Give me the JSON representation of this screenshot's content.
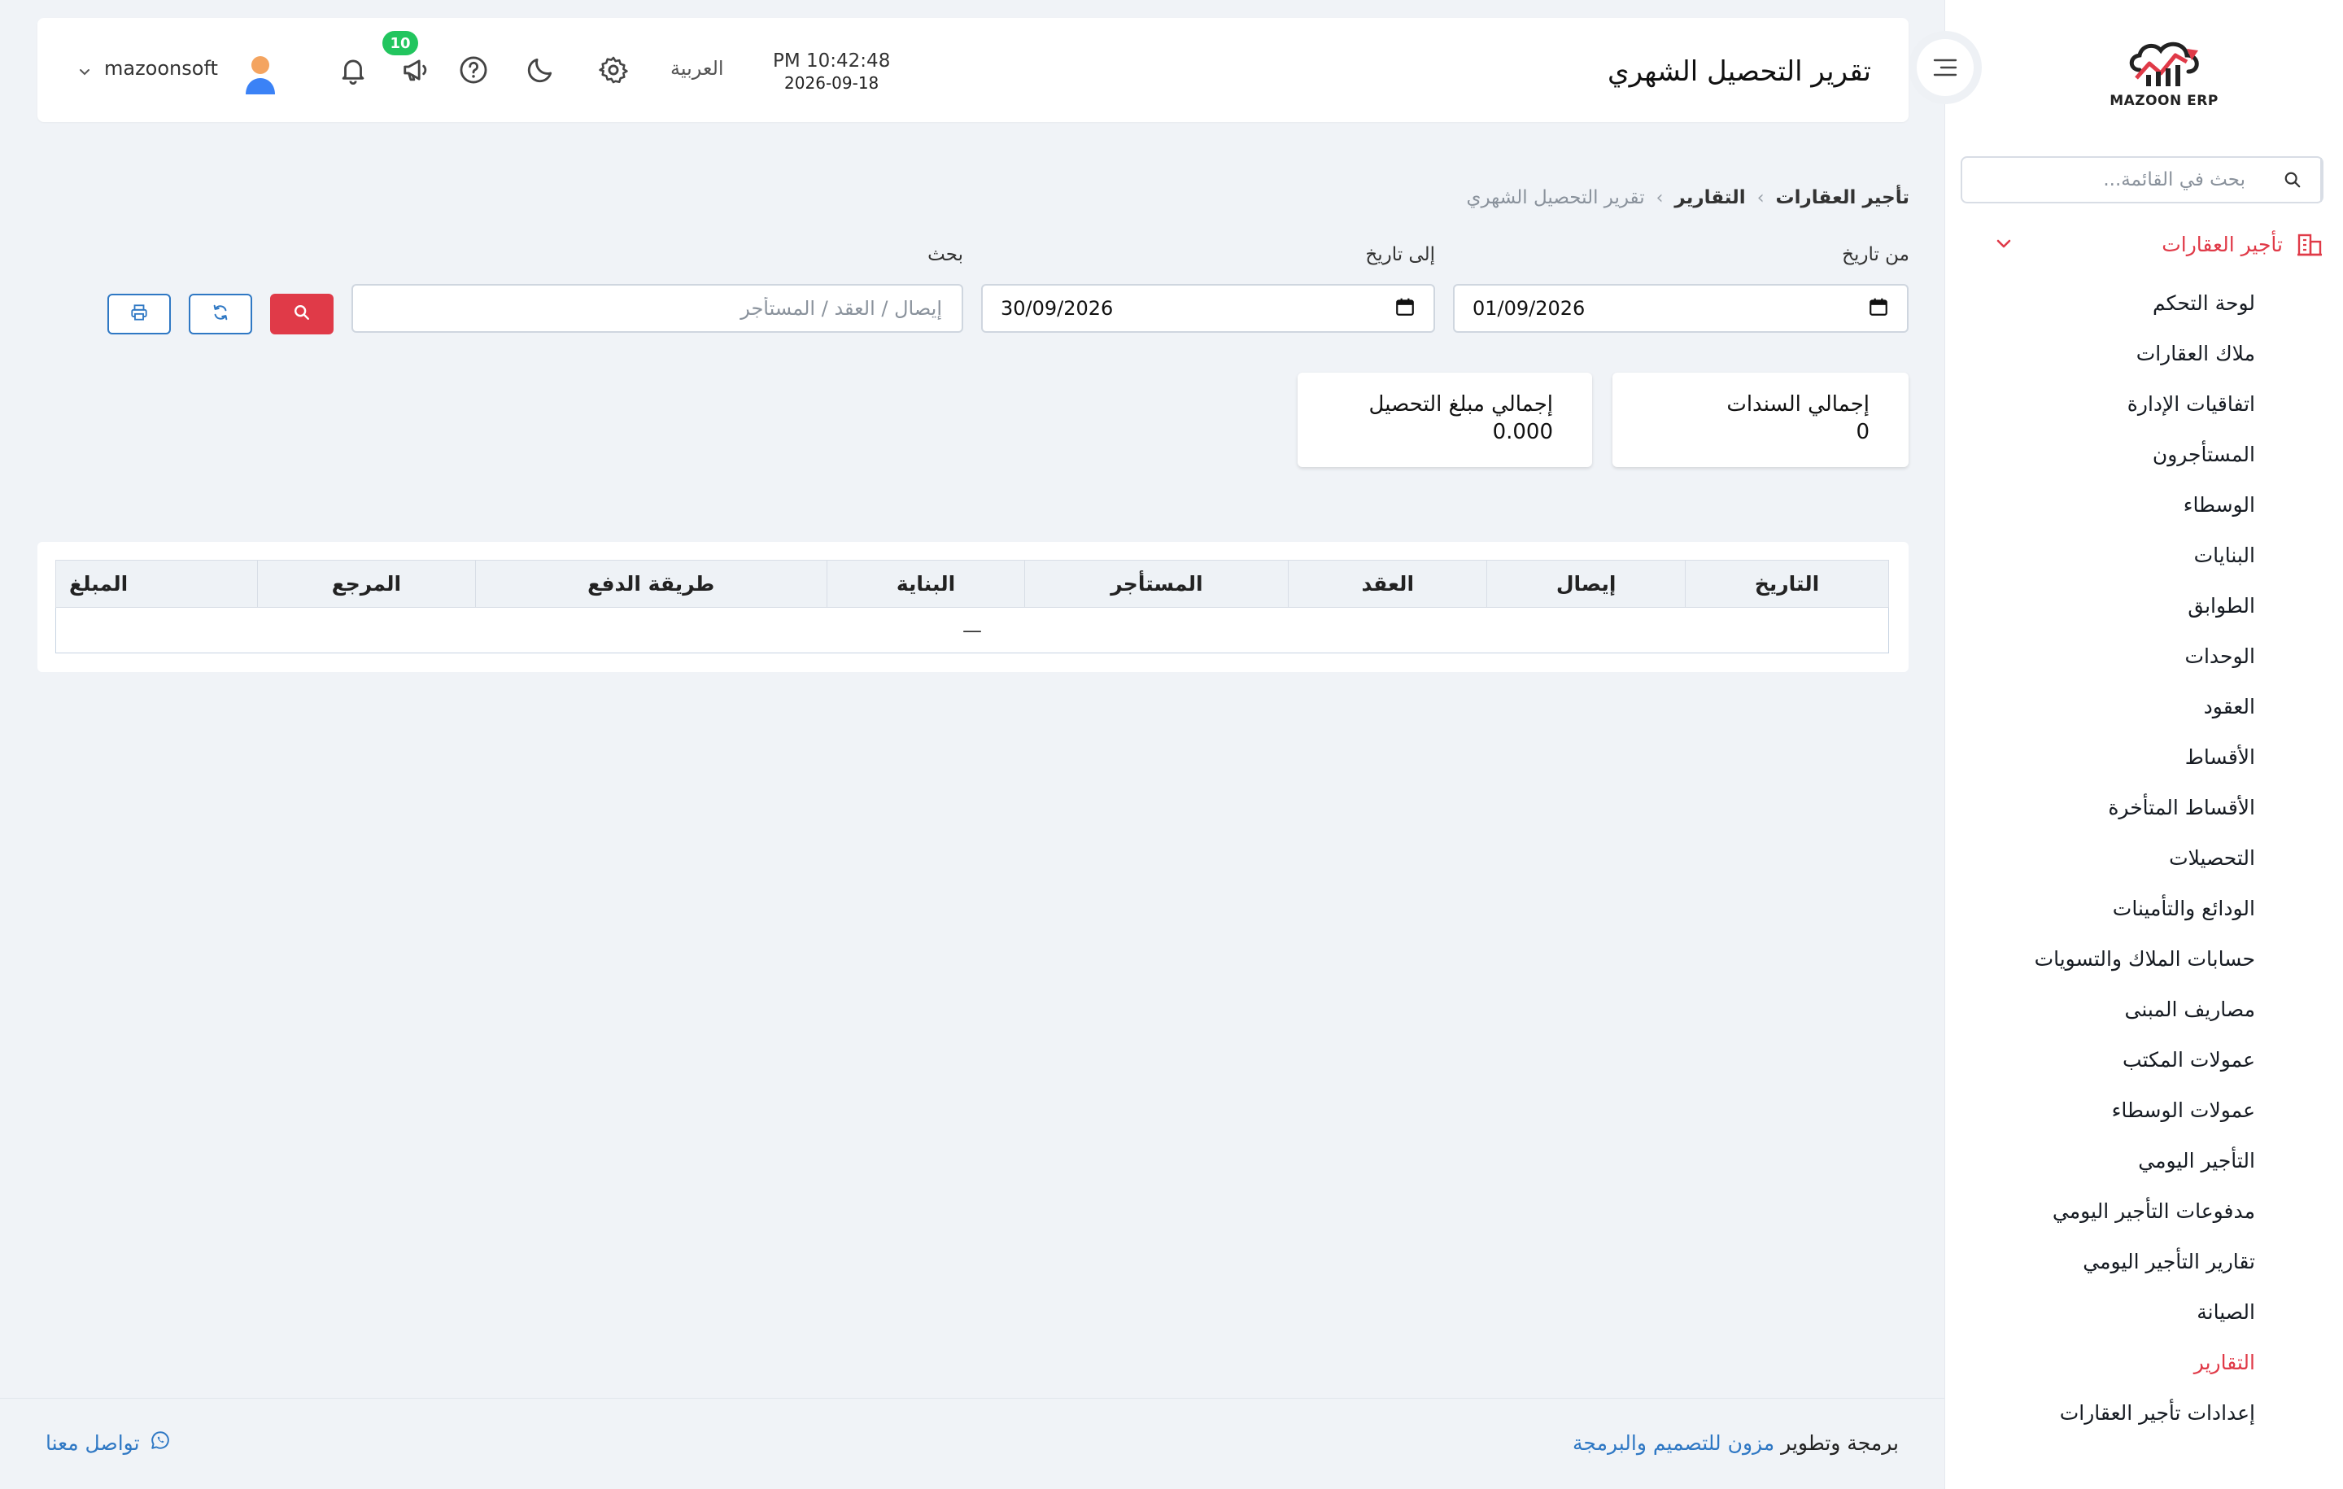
{
  "brand": {
    "logo_text": "MAZOON ERP"
  },
  "sidebar": {
    "search_placeholder": "بحث في القائمة...",
    "group_label": "تأجير العقارات",
    "items": [
      {
        "label": "لوحة التحكم"
      },
      {
        "label": "ملاك العقارات"
      },
      {
        "label": "اتفاقيات الإدارة"
      },
      {
        "label": "المستأجرون"
      },
      {
        "label": "الوسطاء"
      },
      {
        "label": "البنايات"
      },
      {
        "label": "الطوابق"
      },
      {
        "label": "الوحدات"
      },
      {
        "label": "العقود"
      },
      {
        "label": "الأقساط"
      },
      {
        "label": "الأقساط المتأخرة"
      },
      {
        "label": "التحصيلات"
      },
      {
        "label": "الودائع والتأمينات"
      },
      {
        "label": "حسابات الملاك والتسويات"
      },
      {
        "label": "مصاريف المبنى"
      },
      {
        "label": "عمولات المكتب"
      },
      {
        "label": "عمولات الوسطاء"
      },
      {
        "label": "التأجير اليومي"
      },
      {
        "label": "مدفوعات التأجير اليومي"
      },
      {
        "label": "تقارير التأجير اليومي"
      },
      {
        "label": "الصيانة"
      },
      {
        "label": "التقارير",
        "active": true
      },
      {
        "label": "إعدادات تأجير العقارات"
      }
    ]
  },
  "header": {
    "title": "تقرير التحصيل الشهري",
    "time": "PM 10:42:48",
    "date": "2026-09-18",
    "language": "العربية",
    "notification_count": "10",
    "username": "mazoonsoft"
  },
  "breadcrumb": [
    "تأجير العقارات",
    "التقارير",
    "تقرير التحصيل الشهري"
  ],
  "filters": {
    "from_label": "من تاريخ",
    "from_value": "01/09/2026",
    "to_label": "إلى تاريخ",
    "to_value": "30/09/2026",
    "search_label": "بحث",
    "search_placeholder": "إيصال / العقد / المستأجر"
  },
  "summary": {
    "total_vouchers_label": "إجمالي السندات",
    "total_vouchers_value": "0",
    "total_amount_label": "إجمالي مبلغ التحصيل",
    "total_amount_value": "0.000"
  },
  "table": {
    "columns": [
      "التاريخ",
      "إيصال",
      "العقد",
      "المستأجر",
      "البناية",
      "طريقة الدفع",
      "المرجع",
      "المبلغ"
    ],
    "empty_text": "—"
  },
  "footer": {
    "credit_prefix": "برمجة وتطوير",
    "credit_link": "مزون للتصميم والبرمجة",
    "contact": "تواصل معنا"
  },
  "colors": {
    "accent": "#e03a48",
    "link": "#2f78c4",
    "badge": "#22c55e"
  }
}
